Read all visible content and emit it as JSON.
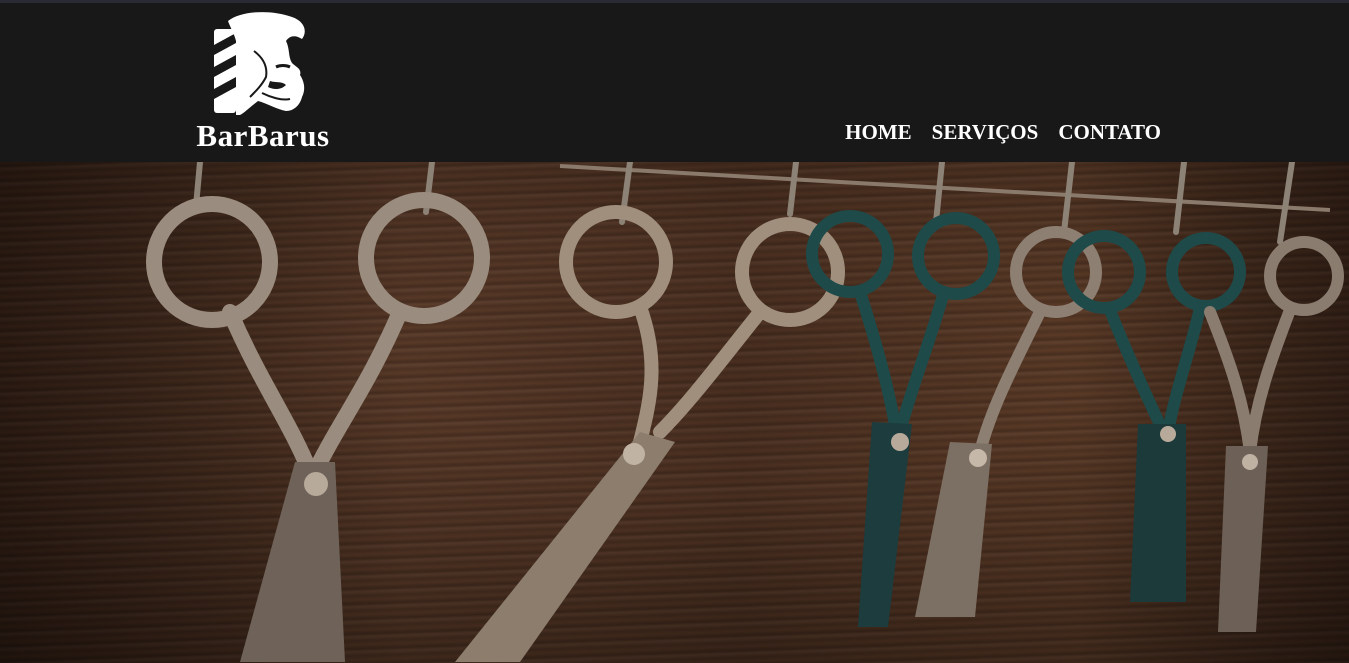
{
  "brand": {
    "name": "BarBarus"
  },
  "nav": {
    "items": [
      {
        "label": "HOME"
      },
      {
        "label": "SERVIÇOS"
      },
      {
        "label": "CONTATO"
      }
    ]
  },
  "hero": {
    "image": "scissors-hanging-on-wall-photo"
  },
  "colors": {
    "header_bg": "#181818",
    "nav_text": "#ffffff",
    "wood_dark": "#3a2418",
    "wood_mid": "#5a3a28"
  }
}
